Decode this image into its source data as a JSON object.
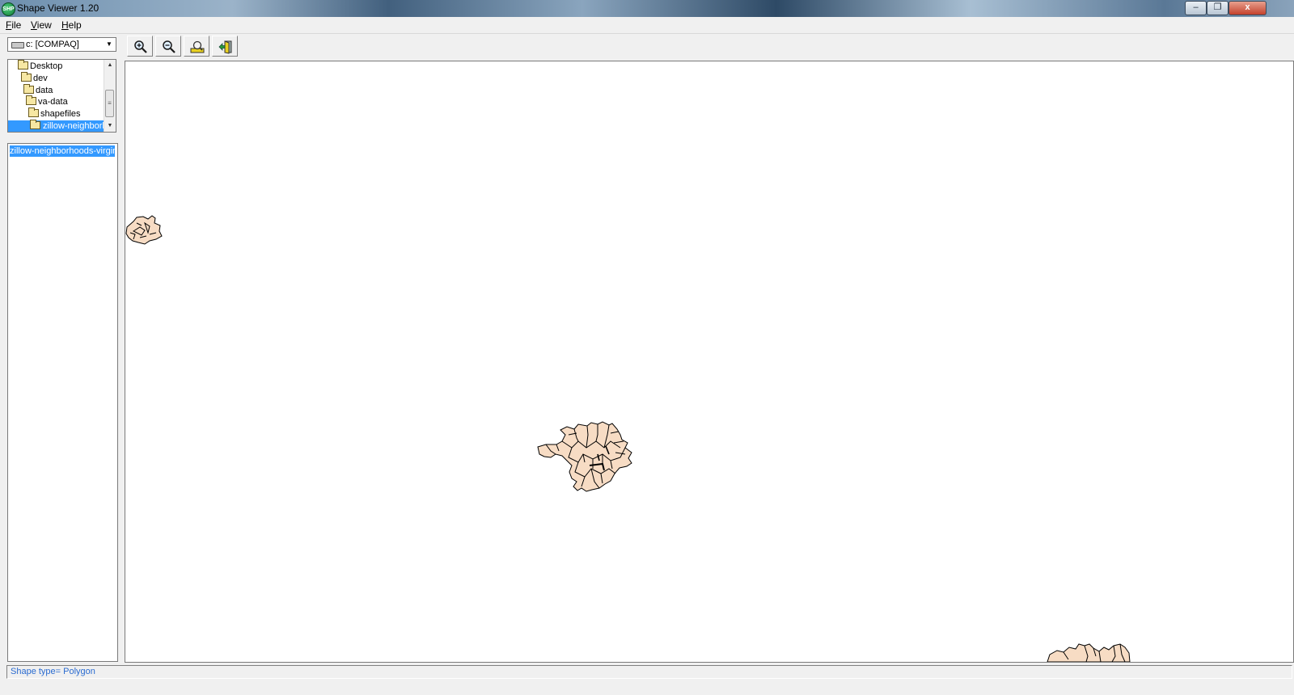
{
  "window": {
    "title": "Shape Viewer 1.20",
    "app_icon_text": "SHP",
    "controls": {
      "minimize": "–",
      "restore": "❐",
      "close": "x"
    }
  },
  "menu": {
    "items": [
      "File",
      "View",
      "Help"
    ]
  },
  "drive": {
    "selected": "c: [COMPAQ]"
  },
  "folder_tree": {
    "items": [
      "Desktop",
      "dev",
      "data",
      "va-data",
      "shapefiles",
      "zillow-neighborh"
    ],
    "selected_index": 5
  },
  "file_list": {
    "items": [
      "zillow-neighborhoods-virginia"
    ]
  },
  "toolbar": {
    "buttons": [
      {
        "icon": "zoom-in-icon"
      },
      {
        "icon": "zoom-out-icon"
      },
      {
        "icon": "full-extent-icon"
      },
      {
        "icon": "exit-icon"
      }
    ]
  },
  "map": {
    "fill_color": "#f7dcc4",
    "stroke_color": "#000000",
    "background": "#ffffff"
  },
  "status": {
    "text": "Shape type= Polygon",
    "text_color": "#2a6bd0"
  }
}
